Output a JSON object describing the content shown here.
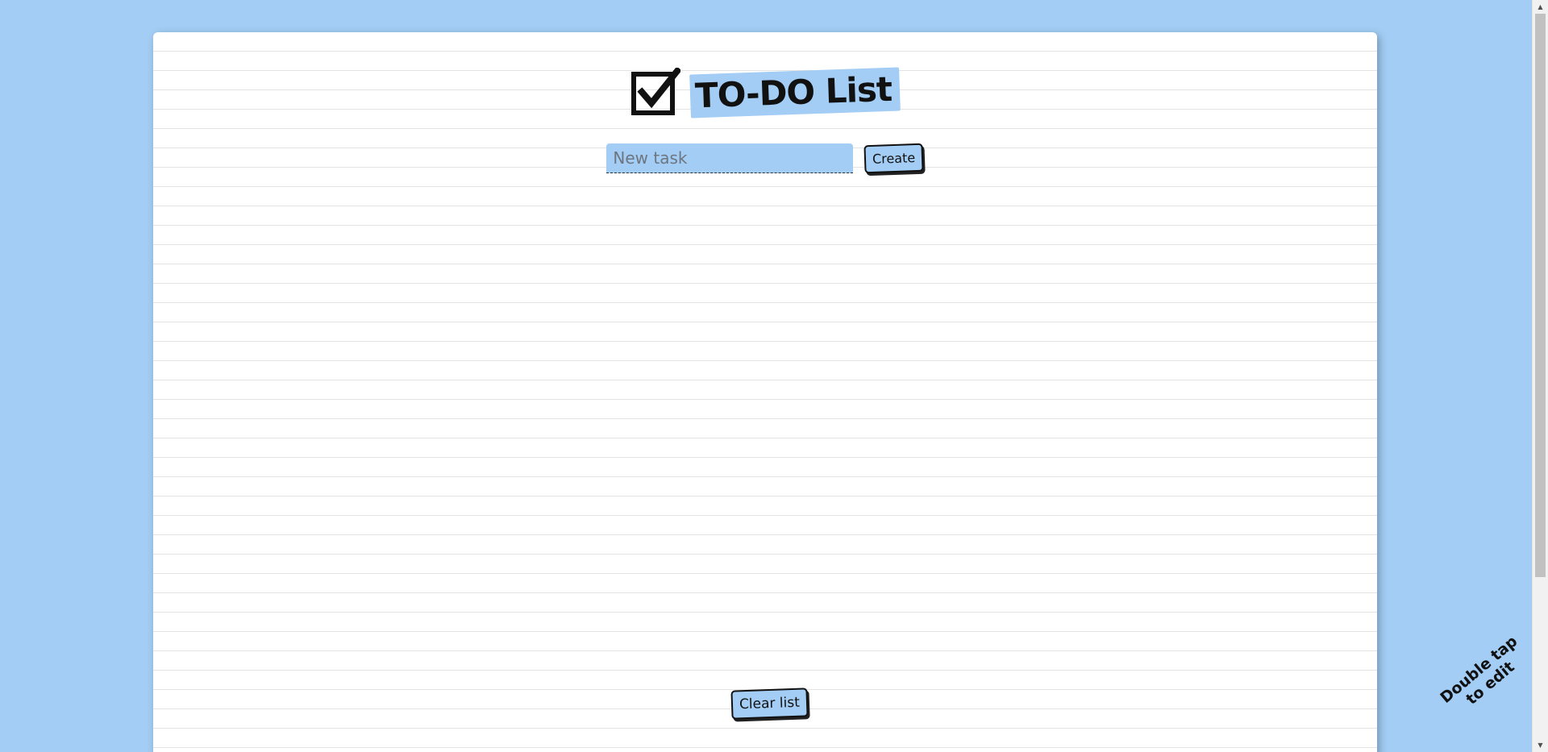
{
  "header": {
    "icon": "checkbox-checked-icon",
    "title": "TO-DO List"
  },
  "new_task": {
    "placeholder": "New task",
    "value": "",
    "create_label": "Create"
  },
  "footer": {
    "clear_label": "Clear list"
  },
  "hint": {
    "line1": "Double tap",
    "line2": "to edit"
  },
  "colors": {
    "background": "#a3cdf4",
    "accent": "#a3cdf4",
    "paper": "#ffffff",
    "ink": "#111111"
  },
  "scrollbar": {
    "up_icon": "scroll-up-arrow-icon",
    "down_icon": "scroll-down-arrow-icon"
  }
}
